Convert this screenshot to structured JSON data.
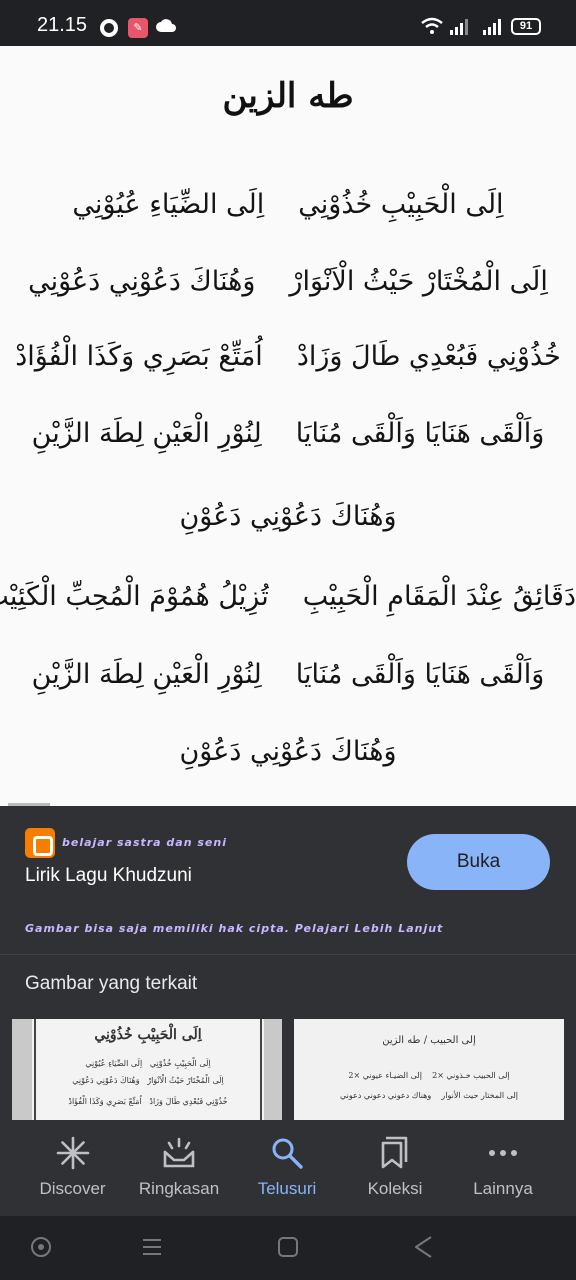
{
  "status_bar": {
    "time": "21.15",
    "battery": "91",
    "icons": [
      "opera-icon",
      "app-notification-icon",
      "cloud-icon",
      "wifi-icon",
      "signal-icon",
      "signal-icon",
      "battery-icon"
    ]
  },
  "image": {
    "title": "طه الزين",
    "lines": [
      [
        "اِلَى الْحَبِيْبِ خُذُوْنِي",
        "اِلَى الضِّيَاءِ عُيُوْنِي"
      ],
      [
        "اِلَى الْمُخْتَارْ حَيْثُ الْاَنْوَارْ",
        "وَهُنَاكَ دَعُوْنِي دَعُوْنِي"
      ],
      [
        "خُذُوْنِي فَبُعْدِي طَالَ وَزَادْ",
        "اُمَتِّعْ بَصَرِي وَكَذَا الْفُؤَادْ"
      ],
      [
        "وَاَلْقَى هَنَايَا وَاَلْقَى مُنَايَا",
        "لِنُوْرِ الْعَيْنِ لِطَهَ الزَّيْنِ"
      ],
      [
        "وَهُنَاكَ دَعُوْنِي دَعُوْنِ"
      ],
      [
        "دَقَائِقُ عِنْدَ الْمَقَامِ الْحَبِيْبِ",
        "تُزِيْلُ هُمُوْمَ الْمُحِبِّ الْكَئِيْبِ"
      ],
      [
        "وَاَلْقَى هَنَايَا وَاَلْقَى مُنَايَا",
        "لِنُوْرِ الْعَيْنِ لِطَهَ الزَّيْنِ"
      ],
      [
        "وَهُنَاكَ دَعُوْنِي دَعُوْنِ"
      ]
    ]
  },
  "info": {
    "source_name": "belajar sastra dan seni",
    "page_title": "Lirik Lagu Khudzuni",
    "open_button": "Buka",
    "copyright_text": "Gambar bisa saja memiliki hak cipta.",
    "copyright_link": "Pelajari Lebih Lanjut"
  },
  "related": {
    "heading": "Gambar yang terkait",
    "thumb1": {
      "title": "اِلَى الْحَبِيْبِ خُذُوْنِي",
      "lines": [
        [
          "اِلَى الْحَبِيْبِ خُذُوْنِي",
          "اِلَى الضِّيَاءِ عُيُوْنِي"
        ],
        [
          "اِلَى الْمُخْتَارْ حَيْثُ الْاَنْوَارْ",
          "وَهُنَاكَ دَعُوْنِي دَعُوْنِي"
        ],
        [
          "خُذُوْنِي فَبُعْدِي طَالَ وَزَادْ",
          "اُمَتِّعْ بَصَرِي وَكَذَا الْفُؤَادْ"
        ]
      ]
    },
    "thumb2": {
      "title": "إلى الحبيب / طه الزين",
      "lines": [
        [
          "إلى الحبيب خـذوني ×2",
          "إلى الضيـاء عيوني ×2"
        ],
        [
          "إلى المختار حيث الأنوار",
          "وهناك دعوني دعوني دعوني"
        ]
      ]
    }
  },
  "bottom_nav": [
    {
      "label": "Discover",
      "icon": "asterisk-icon",
      "active": false
    },
    {
      "label": "Ringkasan",
      "icon": "updates-icon",
      "active": false
    },
    {
      "label": "Telusuri",
      "icon": "search-icon",
      "active": true
    },
    {
      "label": "Koleksi",
      "icon": "collections-icon",
      "active": false
    },
    {
      "label": "Lainnya",
      "icon": "more-icon",
      "active": false
    }
  ],
  "colors": {
    "accent": "#8ab4f8",
    "panel": "#303134",
    "background": "#202124",
    "source_text": "#c8b7ff",
    "blogger": "#f57d00"
  }
}
